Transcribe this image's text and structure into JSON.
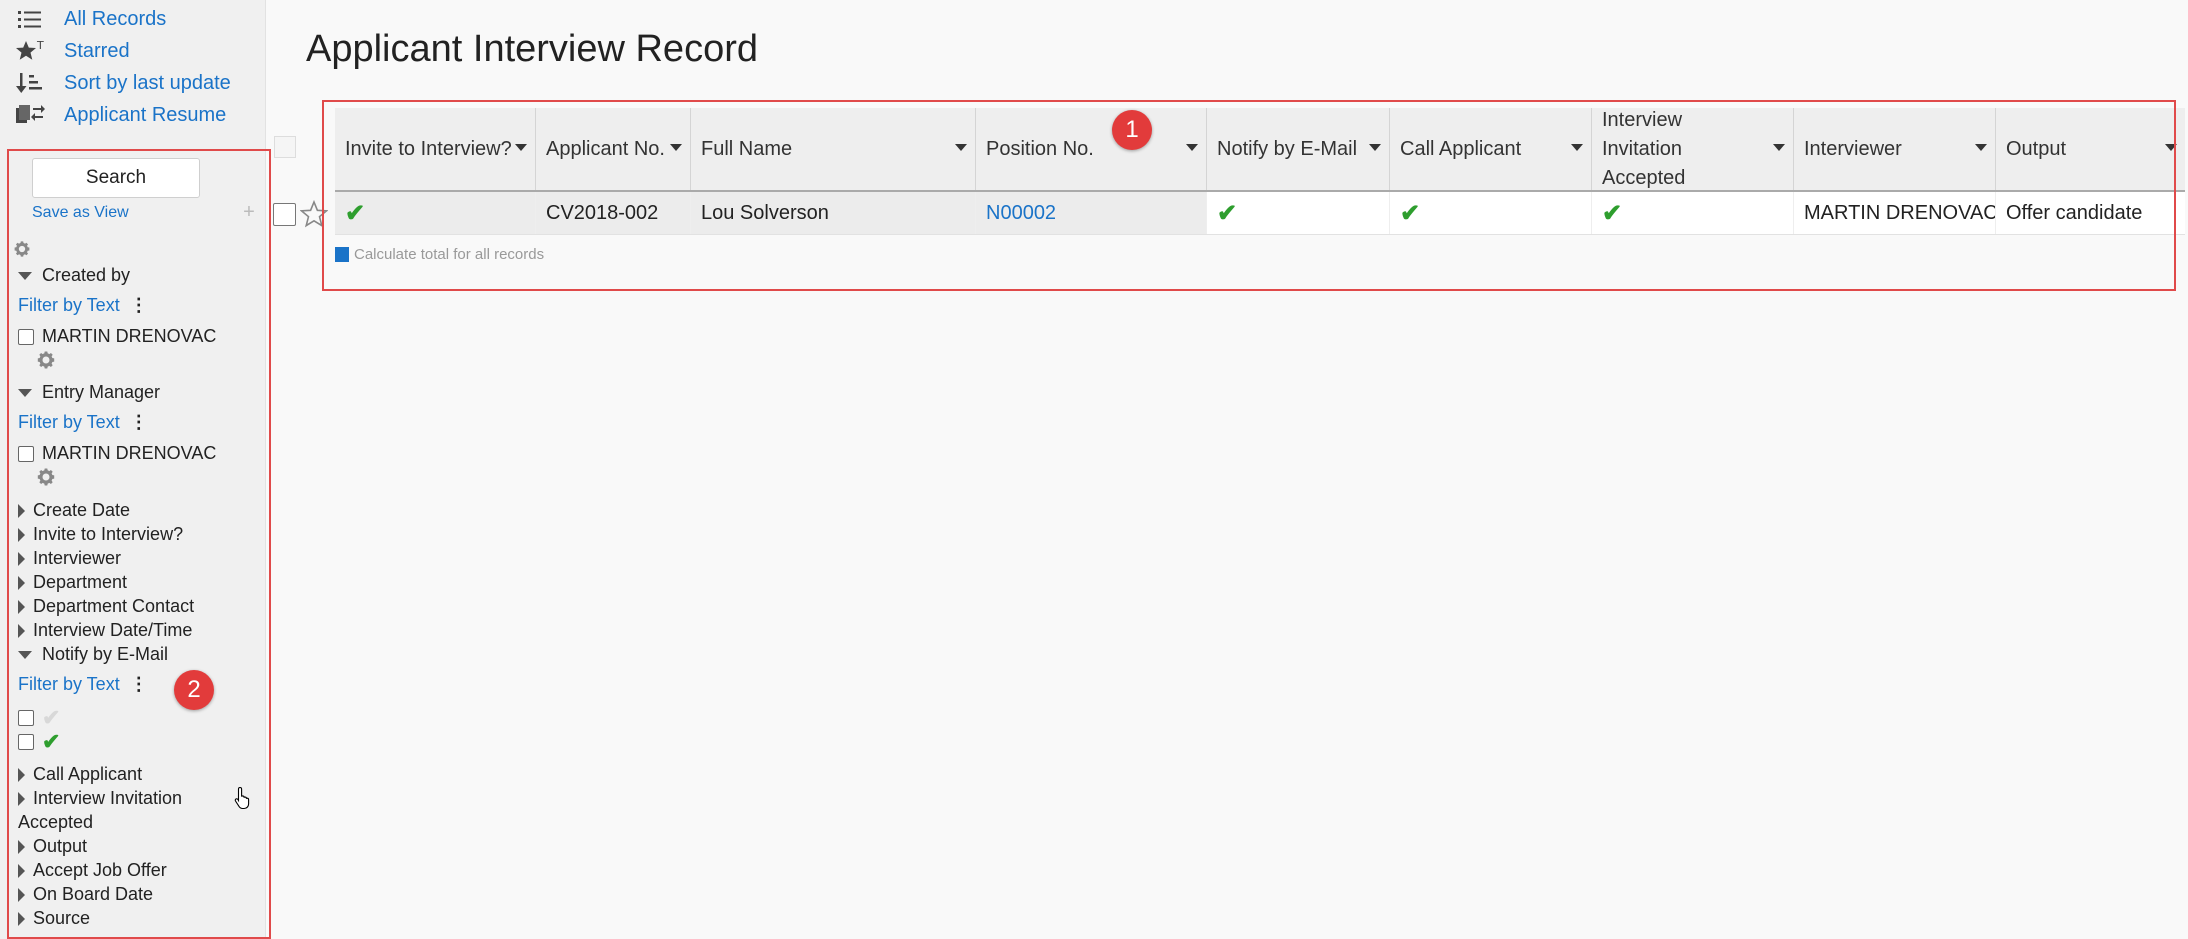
{
  "sidebar": {
    "nav": [
      {
        "label": "All Records",
        "icon": "list-icon"
      },
      {
        "label": "Starred",
        "icon": "star-filter-icon"
      },
      {
        "label": "Sort by last update",
        "icon": "sort-icon"
      },
      {
        "label": "Applicant Resume",
        "icon": "related-table-icon"
      }
    ],
    "search_label": "Search",
    "save_view_label": "Save as View",
    "plus_label": "+",
    "filter_label": "Filter by Text",
    "kebab": "⋮",
    "groups": {
      "created_by": {
        "label": "Created by",
        "option": "MARTIN DRENOVAC"
      },
      "entry_manager": {
        "label": "Entry Manager",
        "option": "MARTIN DRENOVAC"
      },
      "collapsed_a": [
        "Create Date",
        "Invite to Interview?",
        "Interviewer",
        "Department",
        "Department Contact",
        "Interview Date/Time"
      ],
      "notify": {
        "label": "Notify by E-Mail"
      },
      "call_applicant": "Call Applicant",
      "interview_accepted_1": "Interview Invitation",
      "interview_accepted_2": "Accepted",
      "collapsed_b": [
        "Output",
        "Accept Job Offer",
        "On Board Date",
        "Source"
      ]
    }
  },
  "main": {
    "title": "Applicant Interview Record",
    "columns": [
      "Invite to Interview?",
      "Applicant No.",
      "Full Name",
      "Position No.",
      "Notify by E-Mail",
      "Call Applicant",
      "Interview Invitation Accepted",
      "Interviewer",
      "Output"
    ],
    "row": {
      "invite": "✔",
      "applicant_no": "CV2018-002",
      "full_name": "Lou Solverson",
      "position_no": "N00002",
      "notify": "✔",
      "call": "✔",
      "accepted": "✔",
      "interviewer": "MARTIN DRENOVAC",
      "output": "Offer candidate"
    },
    "calc_label": "Calculate total for all records"
  },
  "annotations": {
    "badge1": "1",
    "badge2": "2"
  },
  "colors": {
    "accent": "#1a73c8",
    "check": "#2e9e2e",
    "annotation": "#e23b3b"
  }
}
